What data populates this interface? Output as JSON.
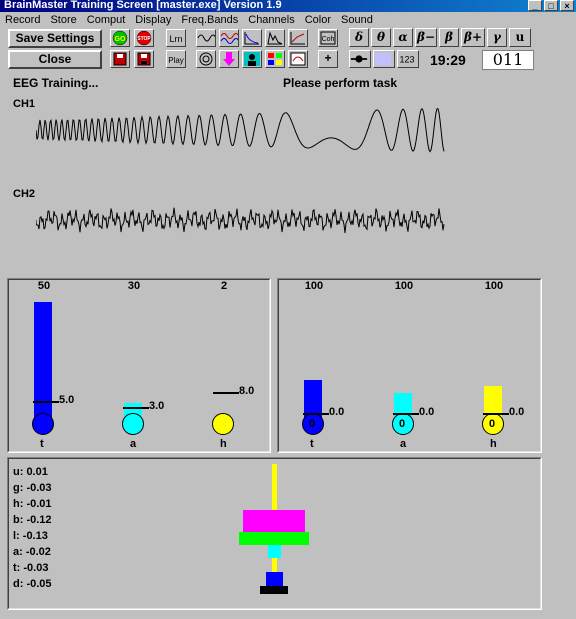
{
  "window": {
    "title": "BrainMaster Training Screen [master.exe]     Version 1.9"
  },
  "menu": [
    "Record",
    "Store",
    "Comput",
    "Display",
    "Freq.Bands",
    "Channels",
    "Color",
    "Sound"
  ],
  "toolbar": {
    "save_label": "Save Settings",
    "close_label": "Close",
    "go_label": "GO",
    "stop_label": "STOP",
    "plus_label": "+",
    "num_label": "123",
    "greek": [
      "δ",
      "θ",
      "α",
      "β−",
      "β",
      "β+",
      "γ",
      "u"
    ],
    "time": "19:29",
    "counter": "011"
  },
  "status": {
    "left": "EEG Training...",
    "right": "Please perform task"
  },
  "channels": [
    {
      "label": "CH1"
    },
    {
      "label": "CH2"
    }
  ],
  "left_bars": [
    {
      "scale": "50",
      "label": "t",
      "threshold": "5.0",
      "color": "#0000ff",
      "level": 0.9
    },
    {
      "scale": "30",
      "label": "a",
      "threshold": "3.0",
      "color": "#00ffff",
      "level": 0.12
    },
    {
      "scale": "2",
      "label": "h",
      "threshold": "8.0",
      "color": "#ffff00",
      "level": 0.0
    }
  ],
  "right_bars": [
    {
      "scale": "100",
      "label": "t",
      "threshold": "0.0",
      "value": "0",
      "color": "#0000ff",
      "level": 0.3
    },
    {
      "scale": "100",
      "label": "a",
      "threshold": "0.0",
      "value": "0",
      "color": "#00ffff",
      "level": 0.2
    },
    {
      "scale": "100",
      "label": "h",
      "threshold": "0.0",
      "value": "0",
      "color": "#ffff00",
      "level": 0.25
    }
  ],
  "readouts": [
    "u: 0.01",
    "g: -0.03",
    "h: -0.01",
    "b: -0.12",
    "l: -0.13",
    "a: -0.02",
    "t: -0.03",
    "d: -0.05"
  ]
}
